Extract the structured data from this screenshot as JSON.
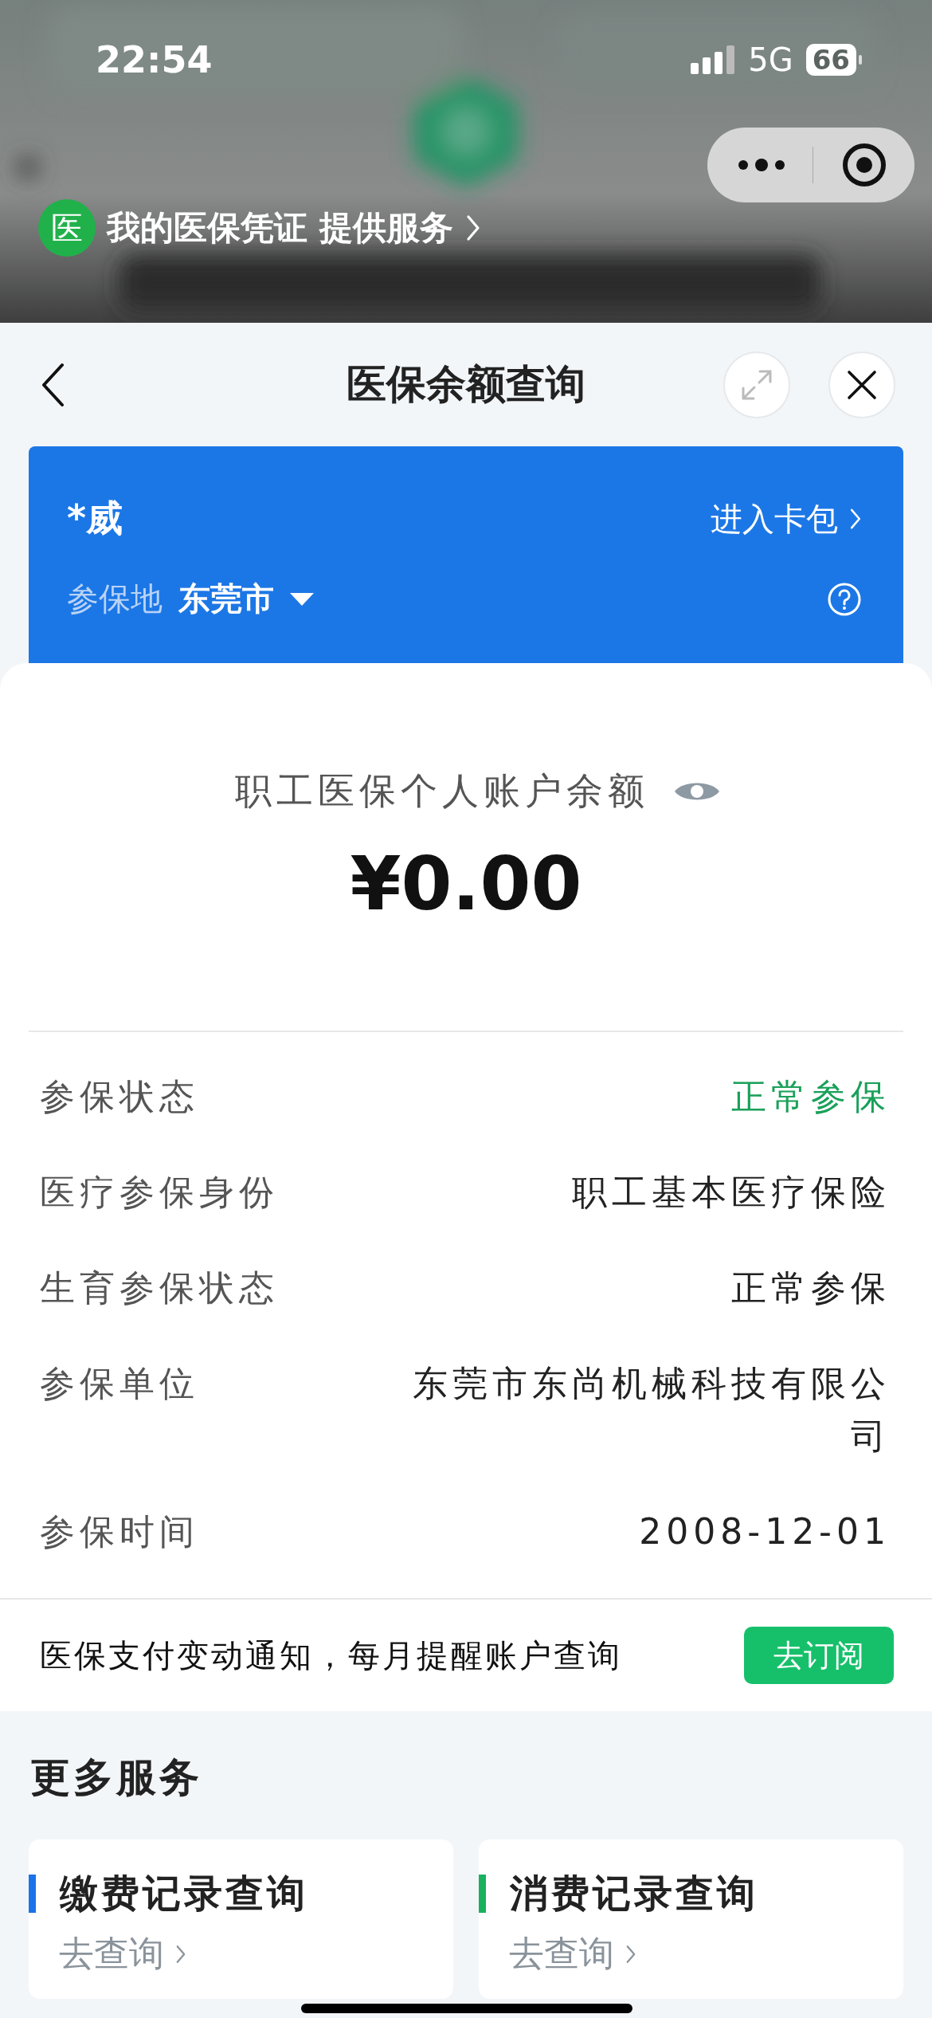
{
  "status_bar": {
    "time": "22:54",
    "network": "5G",
    "battery": "66"
  },
  "service_banner": {
    "badge": "医",
    "text": "我的医保凭证 提供服务"
  },
  "sheet": {
    "title": "医保余额查询"
  },
  "card": {
    "name": "*威",
    "wallet_link": "进入卡包",
    "region_label": "参保地",
    "region": "东莞市"
  },
  "balance": {
    "label": "职工医保个人账户余额",
    "amount": "¥0.00"
  },
  "details": [
    {
      "label": "参保状态",
      "value": "正常参保",
      "kind": "status"
    },
    {
      "label": "医疗参保身份",
      "value": "职工基本医疗保险",
      "kind": "text"
    },
    {
      "label": "生育参保状态",
      "value": "正常参保",
      "kind": "text"
    },
    {
      "label": "参保单位",
      "value": "东莞市东尚机械科技有限公司",
      "kind": "text"
    },
    {
      "label": "参保时间",
      "value": "2008-12-01",
      "kind": "text"
    }
  ],
  "notice": {
    "text": "医保支付变动通知，每月提醒账户查询",
    "button": "去订阅"
  },
  "more_services": {
    "title": "更多服务",
    "items": [
      {
        "title": "缴费记录查询",
        "link": "去查询",
        "color": "#1a73e8"
      },
      {
        "title": "消费记录查询",
        "link": "去查询",
        "color": "#19b15e"
      }
    ]
  }
}
